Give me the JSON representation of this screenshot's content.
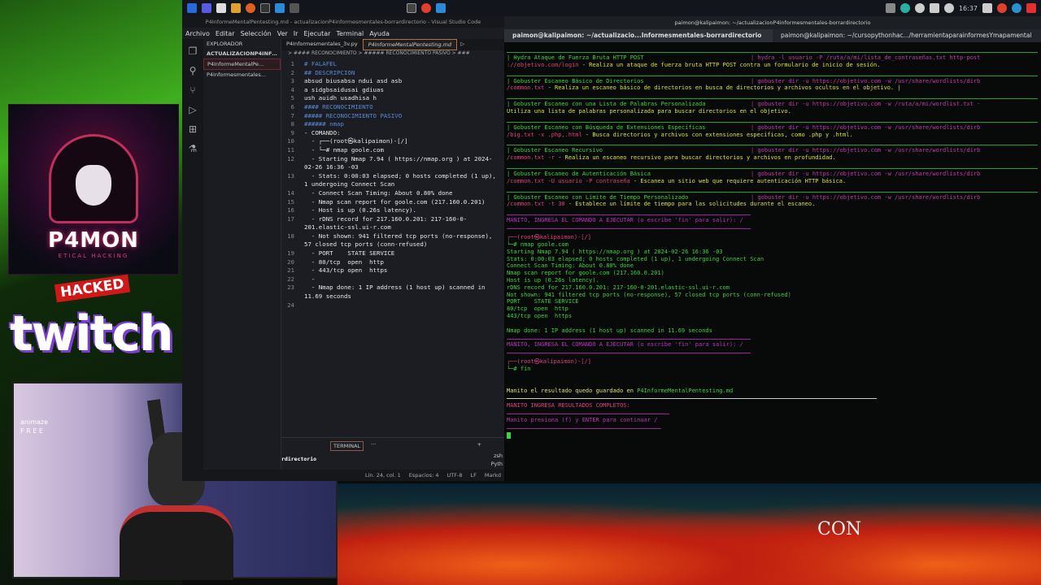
{
  "taskbar": {
    "clock": "16:37"
  },
  "overlay": {
    "logo_text": "P4MON",
    "logo_sub": "ETICAL HACKING",
    "badge": "HACKED",
    "twitch": "twitch",
    "animaze": "animaze",
    "free": "F R E E"
  },
  "vscode": {
    "title": "P4InformeMentalPentesting.md - actualizacionP4informesmentales-borrardirectorio - Visual Studio Code",
    "menu": [
      "Archivo",
      "Editar",
      "Selección",
      "Ver",
      "Ir",
      "Ejecutar",
      "Terminal",
      "Ayuda"
    ],
    "explorer_label": "EXPLORADOR",
    "folder": "ACTUALIZACIONP4INFOR...",
    "files": [
      "P4InformeMentalPe...",
      "P4Informesmentales..."
    ],
    "tabs": [
      "P4Informesmentales_3v.py",
      "P4InformeMentalPentesting.md"
    ],
    "breadcrumb": "> #### RECONOCIMIENTO > ##### RECONOCIMIENTO PASIVO > ###",
    "lines": [
      {
        "n": "1",
        "t": "# FALAFEL",
        "h": true
      },
      {
        "n": "2",
        "t": "## DESCRIPCION",
        "h": true
      },
      {
        "n": "3",
        "t": "absud biusabsa ndui asd asb"
      },
      {
        "n": "4",
        "t": "a sidgbsaidusai gdiuas"
      },
      {
        "n": "5",
        "t": "ush auidh usadhisa h"
      },
      {
        "n": "6",
        "t": "#### RECONOCIMIENTO",
        "h": true
      },
      {
        "n": "7",
        "t": "##### RECONOCIMIENTO PASIVO",
        "h": true
      },
      {
        "n": "8",
        "t": "###### nmap",
        "h": true
      },
      {
        "n": "9",
        "t": "- COMANDO:"
      },
      {
        "n": "10",
        "t": "  - ┌──(root㉿kalipaimon)-[/]"
      },
      {
        "n": "11",
        "t": "  - └─# nmap goole.com"
      },
      {
        "n": "12",
        "t": "  - Starting Nmap 7.94 ( https://nmap.org ) at 2024-02-26 16:36 -03"
      },
      {
        "n": "13",
        "t": "  - Stats: 0:00:03 elapsed; 0 hosts completed (1 up), 1 undergoing Connect Scan"
      },
      {
        "n": "14",
        "t": "  - Connect Scan Timing: About 0.80% done"
      },
      {
        "n": "15",
        "t": "  - Nmap scan report for goole.com (217.160.0.201)"
      },
      {
        "n": "16",
        "t": "  - Host is up (0.26s latency)."
      },
      {
        "n": "17",
        "t": "  - rDNS record for 217.160.0.201: 217-160-0-201.elastic-ssl.ui-r.com"
      },
      {
        "n": "18",
        "t": "  - Not shown: 941 filtered tcp ports (no-response), 57 closed tcp ports (conn-refused)"
      },
      {
        "n": "19",
        "t": "  - PORT    STATE SERVICE"
      },
      {
        "n": "20",
        "t": "  - 80/tcp  open  http"
      },
      {
        "n": "21",
        "t": "  - 443/tcp open  https"
      },
      {
        "n": "22",
        "t": "  -"
      },
      {
        "n": "23",
        "t": "  - Nmap done: 1 IP address (1 host up) scanned in 11.69 seconds"
      },
      {
        "n": "24",
        "t": ""
      }
    ],
    "panel_tab": "TERMINAL",
    "panel_text": "rdirectorio",
    "panel_shells": [
      "zsh",
      "Pyth"
    ],
    "status": {
      "position": "Lín. 24, col. 1",
      "spaces": "Espacios: 4",
      "encoding": "UTF-8",
      "eol": "LF",
      "lang": "Markd"
    }
  },
  "terminal": {
    "title": "paimon@kalipaimon: ~/actualizacionP4informesmentales-borrardirectorio",
    "tabs": [
      "paimon@kalipaimon: ~/actualizacio...Informesmentales-borrardirectorio",
      "paimon@kalipaimon: ~/cursopythonhac.../herramientaparainformesYmapamental"
    ],
    "rows": [
      {
        "name": "| Hydra Ataque de Fuerza Bruta HTTP POST",
        "cmd": "| hydra -l usuario -P /ruta/a/mi/lista_de_contraseñas.txt http-post",
        "l2a": "://objetivo.com/login",
        "l2b": " - Realiza un ataque de fuerza bruta HTTP POST contra un formulario de inicio de sesión."
      },
      {
        "name": "| Gobuster Escaneo Básico de Directorios",
        "cmd": "| gobuster dir -u https://objetivo.com -w /usr/share/wordlists/dirb",
        "l2a": "/common.txt",
        "l2b": " - Realiza un escaneo básico de directorios en busca de directorios y archivos ocultos en el objetivo. |"
      },
      {
        "name": "| Gobuster Escaneo con una Lista de Palabras Personalizada",
        "cmd": "| gobuster dir -u https://objetivo.com -w /ruta/a/mi/wordlist.txt -",
        "l2a": "",
        "l2b": " Utiliza una lista de palabras personalizada para buscar directorios en el objetivo."
      },
      {
        "name": "| Gobuster Escaneo con Búsqueda de Extensiones Específicas",
        "cmd": "| gobuster dir -u https://objetivo.com -w /usr/share/wordlists/dirb",
        "l2a": "/big.txt -x .php,.html",
        "l2b": " - Busca directorios y archivos con extensiones específicas, como .php y .html."
      },
      {
        "name": "| Gobuster Escaneo Recursivo",
        "cmd": "| gobuster dir -u https://objetivo.com -w /usr/share/wordlists/dirb",
        "l2a": "/common.txt -r",
        "l2b": " - Realiza un escaneo recursivo para buscar directorios y archivos en profundidad."
      },
      {
        "name": "| Gobuster Escaneo de Autenticación Básica",
        "cmd": "| gobuster dir -u https://objetivo.com -w /usr/share/wordlists/dirb",
        "l2a": "/common.txt -U usuario -P contraseña",
        "l2b": " - Escanea un sitio web que requiere autenticación HTTP básica."
      },
      {
        "name": "| Gobuster Escaneo con Límite de Tiempo Personalizado",
        "cmd": "| gobuster dir -u https://objetivo.com -w /usr/share/wordlists/dirb",
        "l2a": "/common.txt -t 30",
        "l2b": " - Establece un límite de tiempo para las solicitudes durante el escaneo."
      }
    ],
    "prompt_ask": "MANITO, INGRESA EL COMANDO A EJECUTAR (o escribe 'fin' para salir): /",
    "prompt1": "┌──(root㉿kalipaimon)-[/]",
    "cmd1": "└─# nmap goole.com",
    "output": [
      "Starting Nmap 7.94 ( https://nmap.org ) at 2024-02-26 16:36 -03",
      "Stats: 0:00:03 elapsed; 0 hosts completed (1 up), 1 undergoing Connect Scan",
      "Connect Scan Timing: About 0.80% done",
      "Nmap scan report for goole.com (217.160.0.201)",
      "Host is up (0.26s latency).",
      "rDNS record for 217.160.0.201: 217-160-0-201.elastic-ssl.ui-r.com",
      "Not shown: 941 filtered tcp ports (no-response), 57 closed tcp ports (conn-refused)",
      "PORT    STATE SERVICE",
      "80/tcp  open  http",
      "443/tcp open  https",
      "",
      "Nmap done: 1 IP address (1 host up) scanned in 11.69 seconds"
    ],
    "prompt_ask2": "MANITO, INGRESA EL COMANDO A EJECUTAR (o escribe 'fin' para salir): /",
    "prompt2": "┌──(root㉿kalipaimon)-[/]",
    "cmd2": "└─# fin",
    "saved_text": "Manito el resultado quedo guardado en ",
    "saved_file": "P4InformeMentalPentesting.md",
    "complete": "MANITO INGRESA RESULTADOS COMPLETOS:",
    "continue": "Manito presiona (f) y ENTER para continuar /"
  },
  "banner": {
    "con": "CON"
  }
}
